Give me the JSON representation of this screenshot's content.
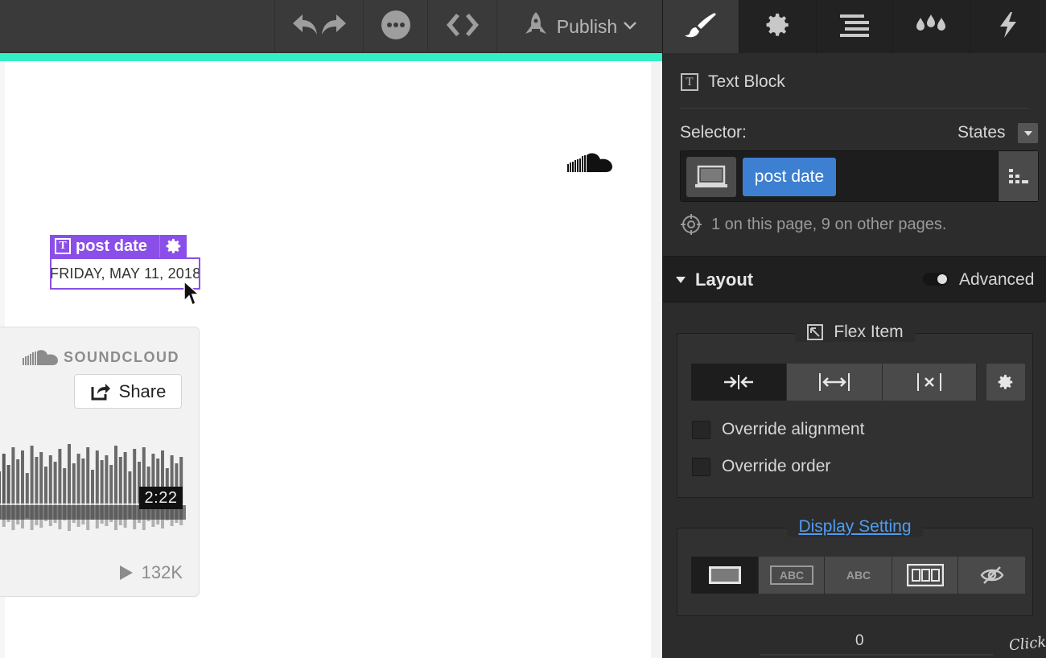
{
  "toolbar": {
    "publish_label": "Publish"
  },
  "canvas": {
    "element_tag_label": "post date",
    "date_text": "FRIDAY, MAY 11, 2018",
    "embed": {
      "brand": "SOUNDCLOUD",
      "share_label": "Share",
      "duration": "2:22",
      "plays": "132K"
    }
  },
  "panel": {
    "tabs": [
      "brush-icon",
      "gear-icon",
      "navigator-icon",
      "drops-icon",
      "lightning-icon"
    ],
    "element_type": "Text Block",
    "selector_label": "Selector:",
    "states_label": "States",
    "selector_chip": "post date",
    "usage_text": "1 on this page, 9 on other pages.",
    "layout": {
      "title": "Layout",
      "advanced_label": "Advanced",
      "flex_item": {
        "legend": "Flex Item",
        "override_alignment": "Override alignment",
        "override_order": "Override order"
      },
      "display": {
        "legend": "Display Setting",
        "options": [
          "block",
          "inline-block",
          "inline",
          "flex",
          "none"
        ],
        "inline_block_label": "ABC",
        "inline_label": "ABC"
      },
      "value": "0"
    },
    "click_note": "Click"
  },
  "colors": {
    "accent_bar": "#30f0c4",
    "element_highlight": "#8a4fe8",
    "selector_chip": "#3d7fd1",
    "link": "#4f9cf0"
  }
}
